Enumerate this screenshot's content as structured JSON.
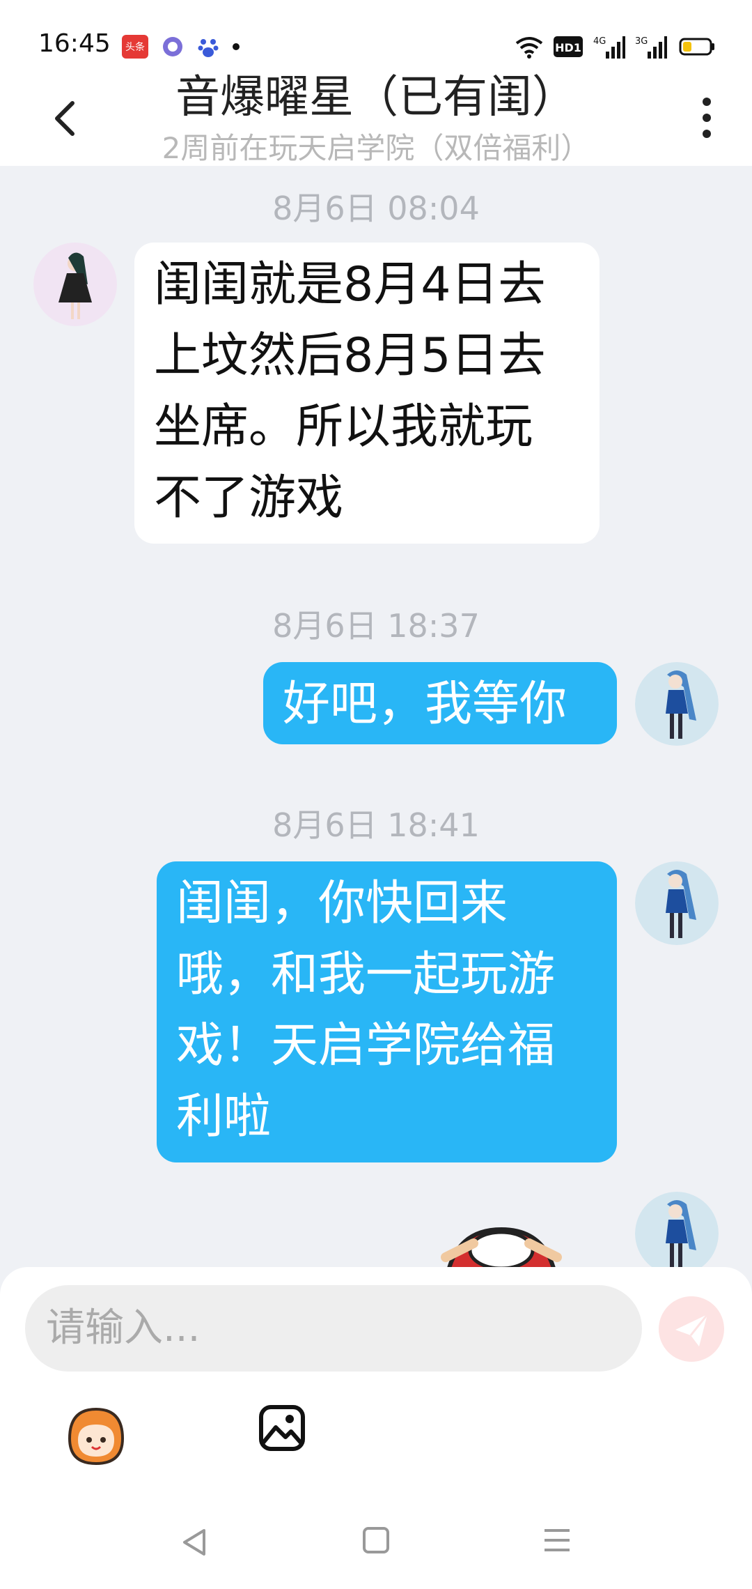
{
  "status_bar": {
    "time": "16:45",
    "app_badge": "头条",
    "hd_label": "HD1",
    "net1": "4G",
    "net2": "3G"
  },
  "header": {
    "title": "音爆曜星（已有闺）",
    "subtitle": "2周前在玩天启学院（双倍福利）"
  },
  "messages": [
    {
      "timestamp": "8月6日 08:04",
      "direction": "in",
      "lines": [
        "闺闺就是8月4日去",
        "上坟然后8月5日去",
        "坐席。所以我就玩",
        "不了游戏"
      ]
    },
    {
      "timestamp": "8月6日 18:37",
      "direction": "out",
      "lines": [
        "好吧，我等你"
      ]
    },
    {
      "timestamp": "8月6日 18:41",
      "direction": "out",
      "lines": [
        "闺闺，你快回来",
        "哦，和我一起玩游",
        "戏！天启学院给福",
        "利啦"
      ]
    }
  ],
  "input": {
    "placeholder": "请输入..."
  },
  "colors": {
    "outgoing_bubble": "#29b6f6",
    "incoming_bubble": "#ffffff",
    "background": "#eff1f5",
    "send_button": "#fde3e3"
  },
  "icons": [
    "back-icon",
    "more-icon",
    "send-icon",
    "emoji-icon",
    "image-icon",
    "nav-back-icon",
    "nav-home-icon",
    "nav-menu-icon"
  ]
}
